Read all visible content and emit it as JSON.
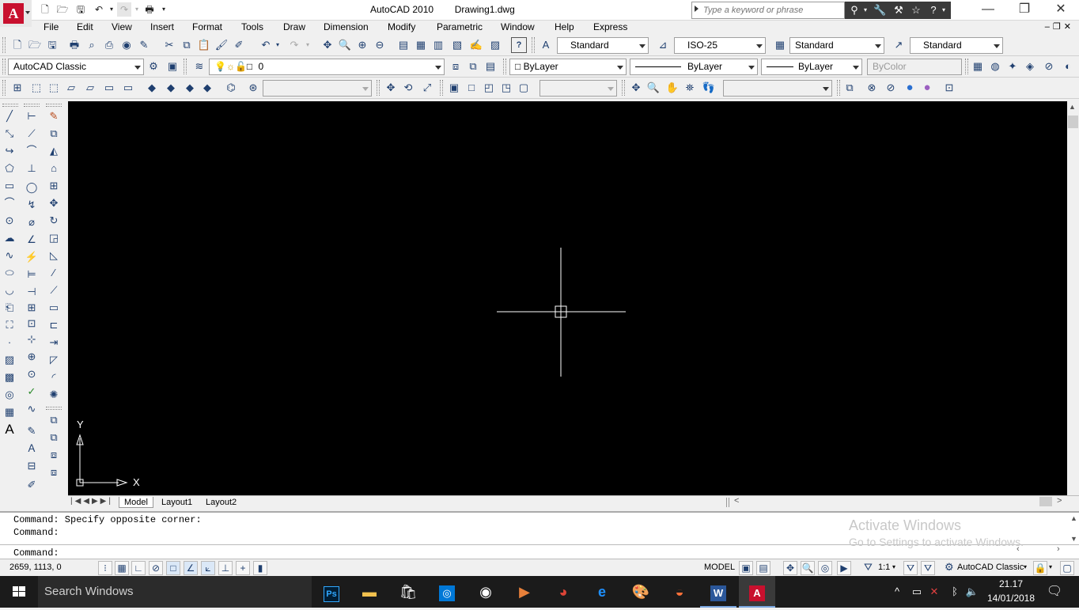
{
  "title_bar": {
    "app_name": "AutoCAD 2010",
    "file_name": "Drawing1.dwg",
    "search_placeholder": "Type a keyword or phrase",
    "logo_letter": "A"
  },
  "menu": [
    "File",
    "Edit",
    "View",
    "Insert",
    "Format",
    "Tools",
    "Draw",
    "Dimension",
    "Modify",
    "Parametric",
    "Window",
    "Help",
    "Express"
  ],
  "styles_toolbar": {
    "text_style": "Standard",
    "dim_style": "ISO-25",
    "table_style": "Standard",
    "mleader_style": "Standard"
  },
  "workspace": "AutoCAD Classic",
  "layer": {
    "current": "0"
  },
  "properties": {
    "color": "ByLayer",
    "linetype": "ByLayer",
    "lineweight": "ByLayer",
    "plot_style": "ByColor"
  },
  "ucs": {
    "y_label": "Y",
    "x_label": "X"
  },
  "layout_tabs": [
    "Model",
    "Layout1",
    "Layout2"
  ],
  "command_history": [
    "Command: Specify opposite corner:",
    "Command:"
  ],
  "command_prompt": "Command:",
  "watermark": {
    "line1": "Activate Windows",
    "line2": "Go to Settings to activate Windows."
  },
  "status": {
    "coordinates": "2659, 1113, 0",
    "model_label": "MODEL",
    "annotation_scale": "1:1",
    "workspace_switch": "AutoCAD Classic"
  },
  "taskbar": {
    "search_text": "Search Windows",
    "time": "21.17",
    "date": "14/01/2018"
  },
  "colors": {
    "canvas": "#000000",
    "accent_red": "#c8102e",
    "taskbar": "#1b1b1b"
  }
}
